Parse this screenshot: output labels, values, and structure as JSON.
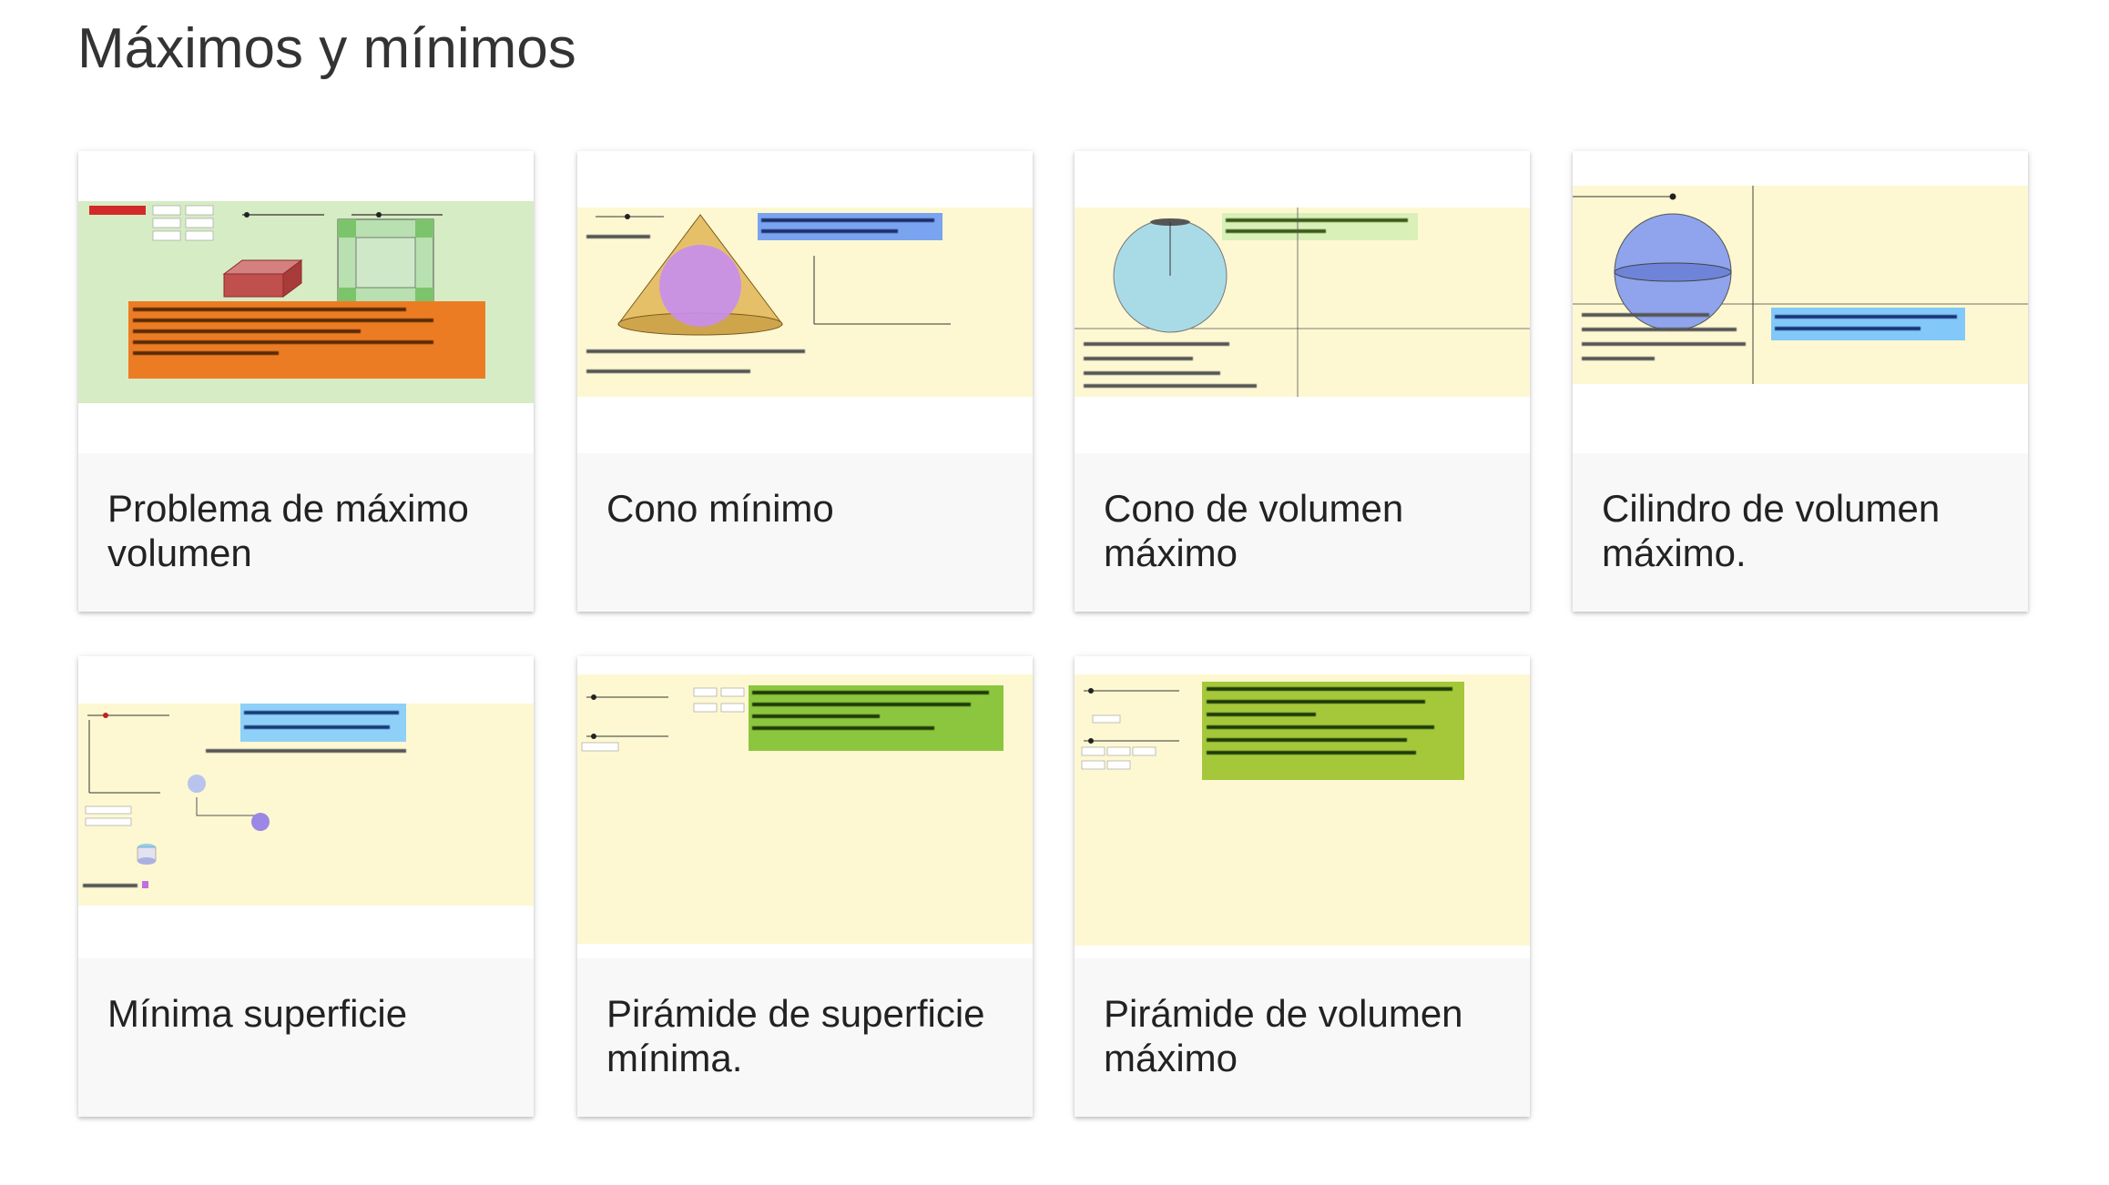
{
  "page": {
    "title": "Máximos y mínimos"
  },
  "cards": [
    {
      "title": "Problema de máximo volumen"
    },
    {
      "title": "Cono mínimo"
    },
    {
      "title": "Cono de volumen máximo"
    },
    {
      "title": "Cilindro de volumen máximo."
    },
    {
      "title": "Mínima superficie"
    },
    {
      "title": "Pirámide de superficie mínima."
    },
    {
      "title": "Pirámide de volumen máximo"
    }
  ],
  "colors": {
    "card_footer": "#f8f8f8",
    "thumb_yellow": "#fdf8d2",
    "thumb_green_bg": "#d6ecc4",
    "orange_box": "#ec7c24",
    "blue_label": "#7aa3f0",
    "green_box": "#8cc63e"
  }
}
